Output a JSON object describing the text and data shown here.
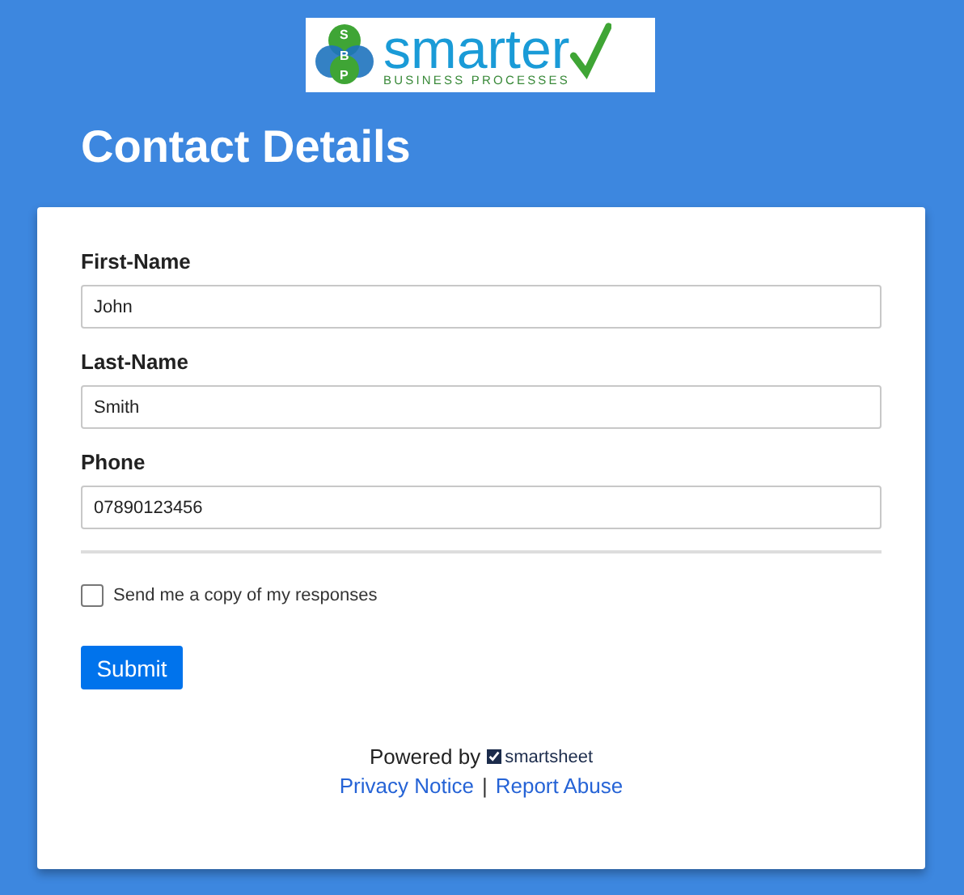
{
  "logo": {
    "letters": [
      "S",
      "B",
      "P"
    ],
    "name": "smarter",
    "tagline": "BUSINESS PROCESSES"
  },
  "title": "Contact Details",
  "fields": [
    {
      "label": "First-Name",
      "value": "John"
    },
    {
      "label": "Last-Name",
      "value": "Smith"
    },
    {
      "label": "Phone",
      "value": "07890123456"
    }
  ],
  "copy_checkbox": {
    "label": "Send me a copy of my responses",
    "checked": false
  },
  "submit": "Submit",
  "footer": {
    "powered_by": "Powered by",
    "brand": "smartsheet",
    "links": [
      "Privacy Notice",
      "Report Abuse"
    ],
    "separator": "|"
  }
}
